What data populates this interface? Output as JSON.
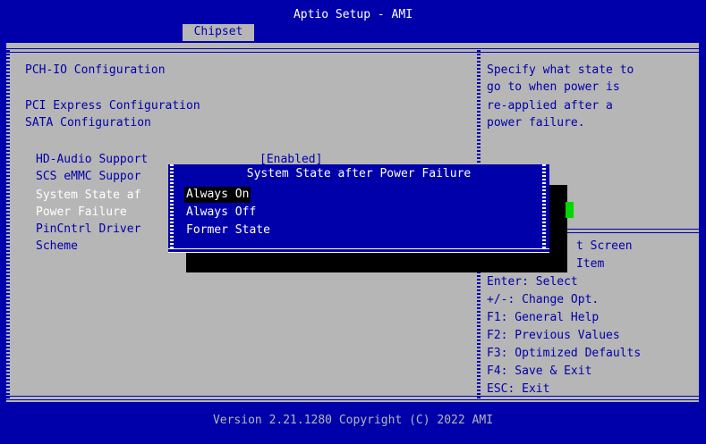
{
  "header": {
    "title": "Aptio Setup - AMI",
    "active_tab": "Chipset"
  },
  "main": {
    "section_title": "PCH-IO Configuration",
    "links": [
      "PCI Express Configuration",
      "SATA Configuration"
    ],
    "settings": [
      {
        "label": "HD-Audio Support",
        "value": "[Enabled]"
      },
      {
        "label": "SCS eMMC Suppor",
        "value": ""
      },
      {
        "label": "System State af",
        "value": ""
      },
      {
        "label": "Power Failure",
        "value": ""
      },
      {
        "label": "PinCntrl Driver",
        "value": ""
      },
      {
        "label": "Scheme",
        "value": ""
      }
    ]
  },
  "help": {
    "lines": [
      "Specify what state to",
      "go to when power is",
      "re-applied after a",
      "power failure."
    ],
    "keys": [
      "t Screen",
      "Item",
      "Enter: Select",
      "+/-: Change Opt.",
      "F1: General Help",
      "F2: Previous Values",
      "F3: Optimized Defaults",
      "F4: Save & Exit",
      "ESC: Exit"
    ]
  },
  "popup": {
    "title": "System State after Power Failure",
    "options": [
      "Always On",
      "Always Off",
      "Former State"
    ],
    "selected_index": 0
  },
  "footer": {
    "version": "Version 2.21.1280 Copyright (C) 2022 AMI"
  }
}
